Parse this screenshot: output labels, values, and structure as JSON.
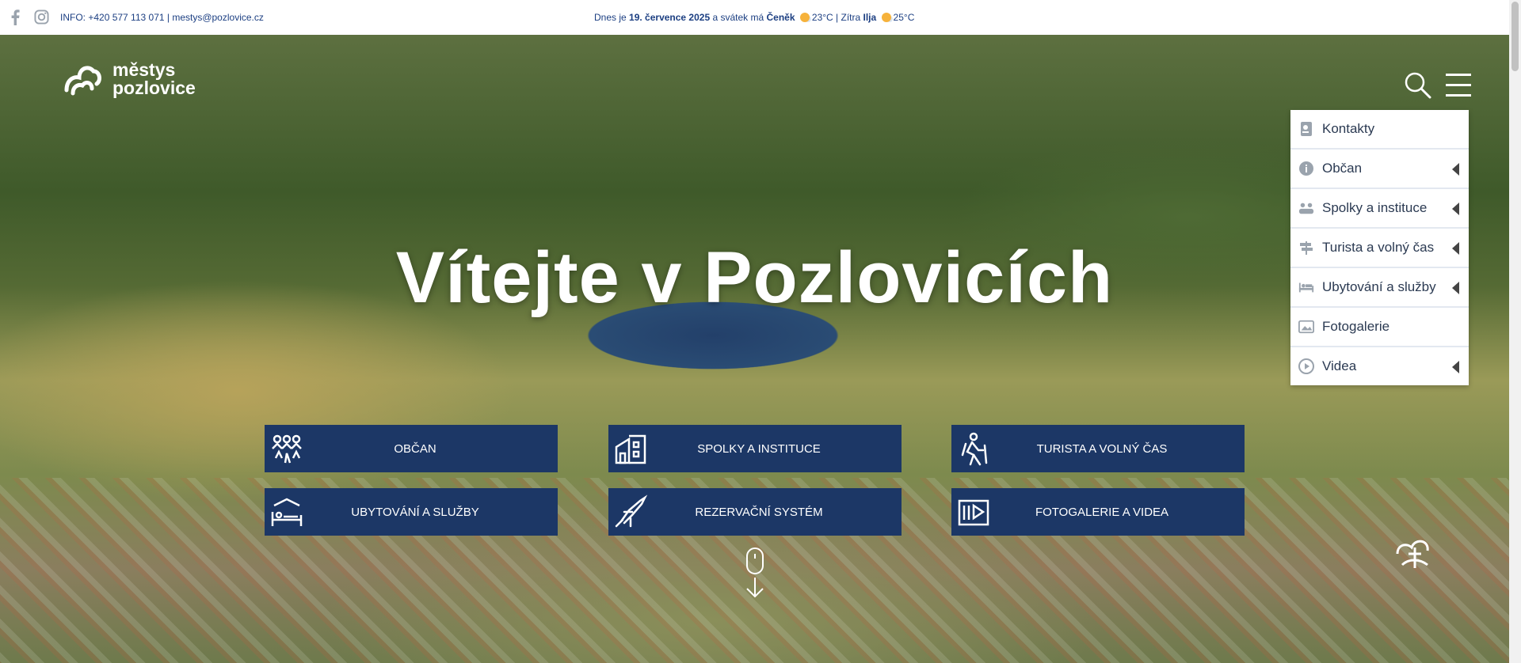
{
  "topbar": {
    "info_label": "INFO: +420 577 113 071 | mestys@pozlovice.cz",
    "today_prefix": "Dnes je",
    "today_date": "19. července 2025",
    "today_mid": "a svátek má",
    "today_name": "Čeněk",
    "today_temp": "23°C",
    "sep": "| Zítra",
    "tomorrow_name": "Ilja",
    "tomorrow_temp": "25°C",
    "social_icons": [
      "facebook-icon",
      "instagram-icon"
    ]
  },
  "brand": {
    "line1": "městys",
    "line2": "pozlovice"
  },
  "hero": {
    "title": "Vítejte v Pozlovicích"
  },
  "menu": {
    "items": [
      {
        "label": "Kontakty",
        "icon": "contact-card-icon",
        "submenu": false
      },
      {
        "label": "Občan",
        "icon": "info-icon",
        "submenu": true
      },
      {
        "label": "Spolky a instituce",
        "icon": "group-icon",
        "submenu": true
      },
      {
        "label": "Turista a volný čas",
        "icon": "signpost-icon",
        "submenu": true
      },
      {
        "label": "Ubytování a služby",
        "icon": "bed-icon",
        "submenu": true
      },
      {
        "label": "Fotogalerie",
        "icon": "gallery-icon",
        "submenu": false
      },
      {
        "label": "Videa",
        "icon": "play-icon",
        "submenu": true
      }
    ]
  },
  "tiles": [
    {
      "label": "OBČAN",
      "icon": "citizens-icon"
    },
    {
      "label": "SPOLKY A INSTITUCE",
      "icon": "building-icon"
    },
    {
      "label": "TURISTA A VOLNÝ ČAS",
      "icon": "hiker-icon"
    },
    {
      "label": "UBYTOVÁNÍ A SLUŽBY",
      "icon": "bed-icon"
    },
    {
      "label": "REZERVAČNÍ SYSTÉM",
      "icon": "reservation-icon"
    },
    {
      "label": "FOTOGALERIE A VIDEA",
      "icon": "media-icon"
    }
  ],
  "colors": {
    "brand_blue": "#1c3766",
    "text_blue": "#1c3f82",
    "weather_sun": "#f6b23b"
  }
}
